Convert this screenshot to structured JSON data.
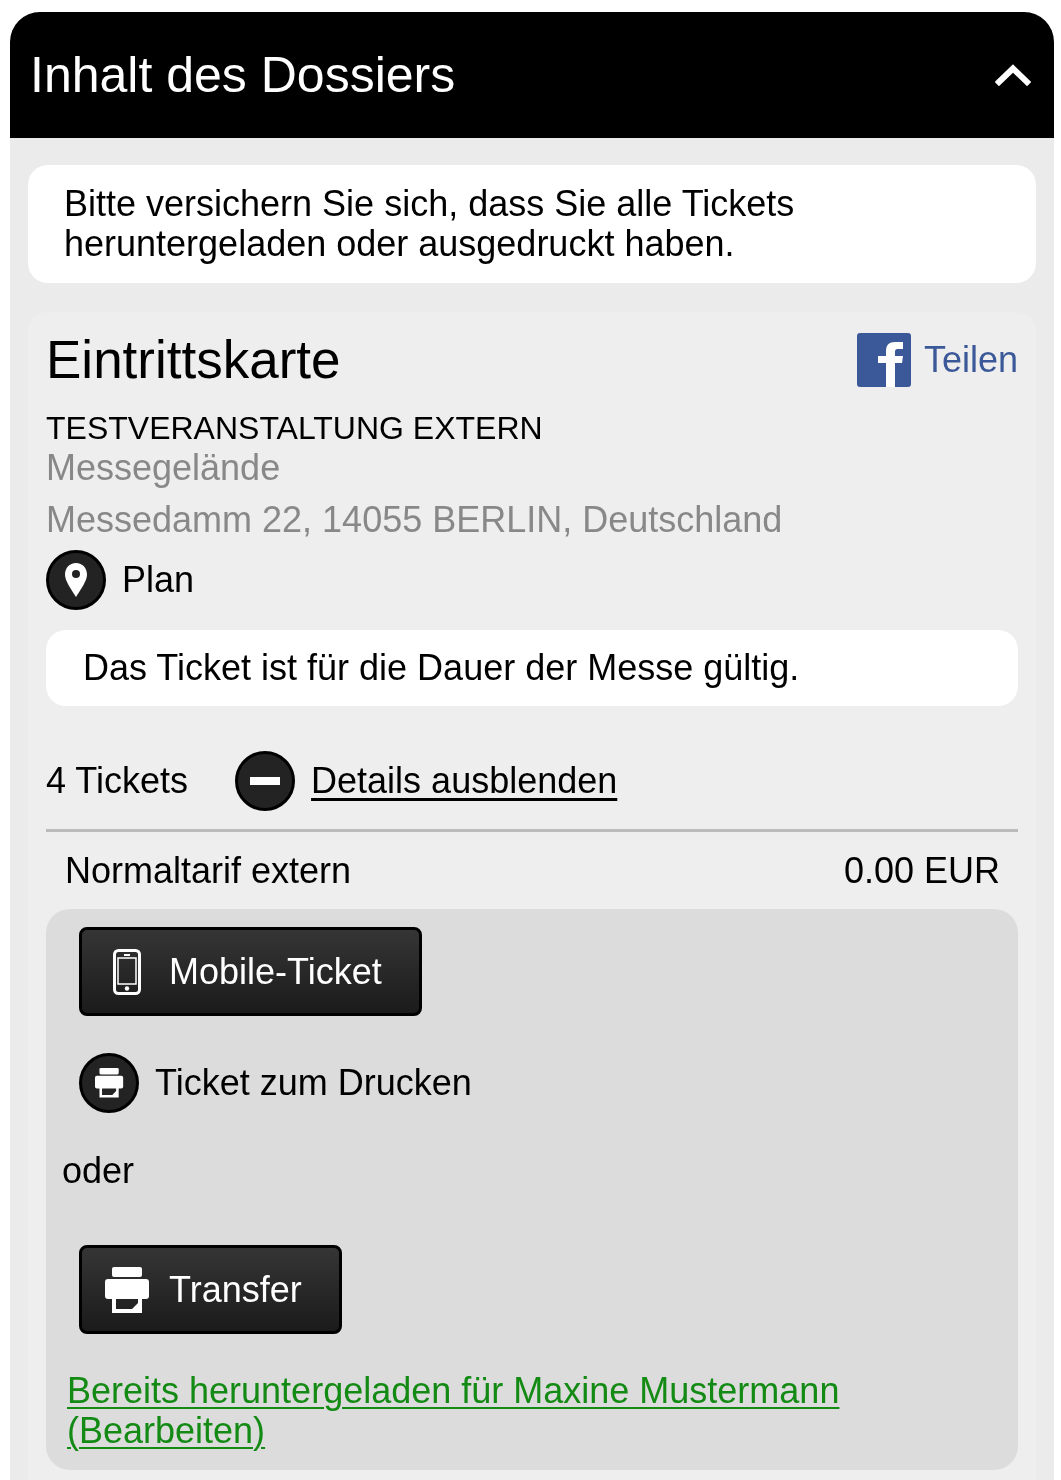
{
  "header": {
    "title": "Inhalt des Dossiers",
    "expanded": true
  },
  "notice": "Bitte versichern Sie sich, dass Sie alle Tickets heruntergeladen oder ausgedruckt haben.",
  "ticket": {
    "title": "Eintrittskarte",
    "share_label": "Teilen",
    "event": "TESTVERANSTALTUNG EXTERN",
    "venue": "Messegelände",
    "address": "Messedamm 22, 14055 BERLIN, Deutschland",
    "map_link": "Plan",
    "validity": "Das Ticket ist für die Dauer der Messe gültig.",
    "count": "4 Tickets",
    "details_toggle": {
      "label": "Details ausblenden",
      "expanded": true
    },
    "tariff": {
      "name": "Normaltarif extern",
      "price": "0.00 EUR"
    },
    "options": [
      {
        "kind": "mobile",
        "label": "Mobile-Ticket"
      },
      {
        "kind": "print",
        "label": "Ticket zum Drucken"
      },
      {
        "kind": "separator",
        "label": "oder"
      },
      {
        "kind": "transfer",
        "label": "Transfer"
      },
      {
        "kind": "status",
        "label": "Bereits heruntergeladen für Maxine Mustermann (Bearbeiten)"
      }
    ]
  }
}
